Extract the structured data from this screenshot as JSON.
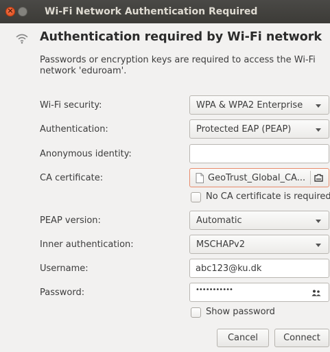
{
  "window": {
    "title": "Wi-Fi Network Authentication Required"
  },
  "header": {
    "icon": "wifi-icon",
    "title": "Authentication required by Wi-Fi network",
    "description": "Passwords or encryption keys are required to access the Wi-Fi network 'eduroam'."
  },
  "form": {
    "wifi_security": {
      "label": "Wi-Fi security:",
      "value": "WPA & WPA2 Enterprise"
    },
    "authentication": {
      "label": "Authentication:",
      "value": "Protected EAP (PEAP)"
    },
    "anonymous_identity": {
      "label": "Anonymous identity:",
      "value": ""
    },
    "ca_certificate": {
      "label": "CA certificate:",
      "value": "GeoTrust_Global_CA...",
      "icon": "document-icon",
      "button_icon": "open-folder-icon"
    },
    "no_ca_required": {
      "label": "No CA certificate is required",
      "checked": false
    },
    "peap_version": {
      "label": "PEAP version:",
      "value": "Automatic"
    },
    "inner_authentication": {
      "label": "Inner authentication:",
      "value": "MSCHAPv2"
    },
    "username": {
      "label": "Username:",
      "value": "abc123@ku.dk"
    },
    "password": {
      "label": "Password:",
      "value": "•••••••••••",
      "icon": "users-icon"
    },
    "show_password": {
      "label": "Show password",
      "checked": false
    }
  },
  "buttons": {
    "cancel": "Cancel",
    "connect": "Connect"
  },
  "colors": {
    "titlebar": "#3c3b37",
    "close_button": "#df4a16",
    "background": "#f2f1f0",
    "focus_border": "#e88a6a"
  }
}
